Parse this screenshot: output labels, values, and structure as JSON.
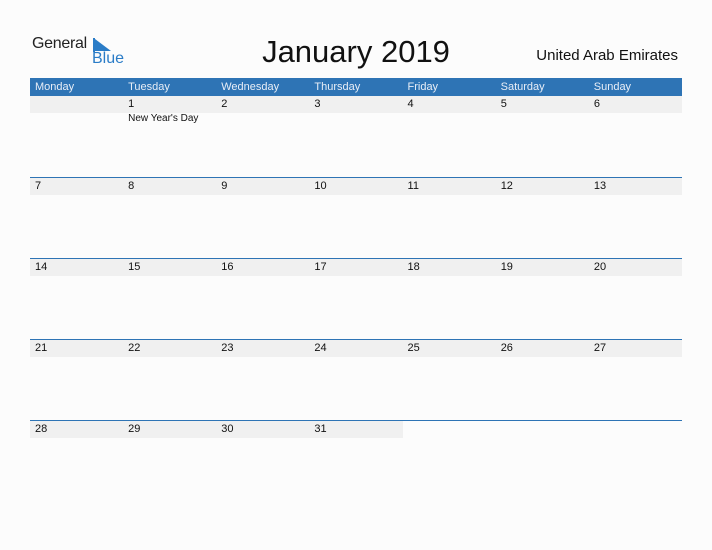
{
  "logo": {
    "line1": "General",
    "line2": "Blue"
  },
  "title": "January 2019",
  "country": "United Arab Emirates",
  "colors": {
    "accent": "#2e74b5",
    "band": "#f0f0f0"
  },
  "weekdays": [
    "Monday",
    "Tuesday",
    "Wednesday",
    "Thursday",
    "Friday",
    "Saturday",
    "Sunday"
  ],
  "weeks": [
    [
      {
        "d": ""
      },
      {
        "d": "1",
        "event": "New Year's Day"
      },
      {
        "d": "2"
      },
      {
        "d": "3"
      },
      {
        "d": "4"
      },
      {
        "d": "5"
      },
      {
        "d": "6"
      }
    ],
    [
      {
        "d": "7"
      },
      {
        "d": "8"
      },
      {
        "d": "9"
      },
      {
        "d": "10"
      },
      {
        "d": "11"
      },
      {
        "d": "12"
      },
      {
        "d": "13"
      }
    ],
    [
      {
        "d": "14"
      },
      {
        "d": "15"
      },
      {
        "d": "16"
      },
      {
        "d": "17"
      },
      {
        "d": "18"
      },
      {
        "d": "19"
      },
      {
        "d": "20"
      }
    ],
    [
      {
        "d": "21"
      },
      {
        "d": "22"
      },
      {
        "d": "23"
      },
      {
        "d": "24"
      },
      {
        "d": "25"
      },
      {
        "d": "26"
      },
      {
        "d": "27"
      }
    ],
    [
      {
        "d": "28"
      },
      {
        "d": "29"
      },
      {
        "d": "30"
      },
      {
        "d": "31"
      }
    ]
  ]
}
